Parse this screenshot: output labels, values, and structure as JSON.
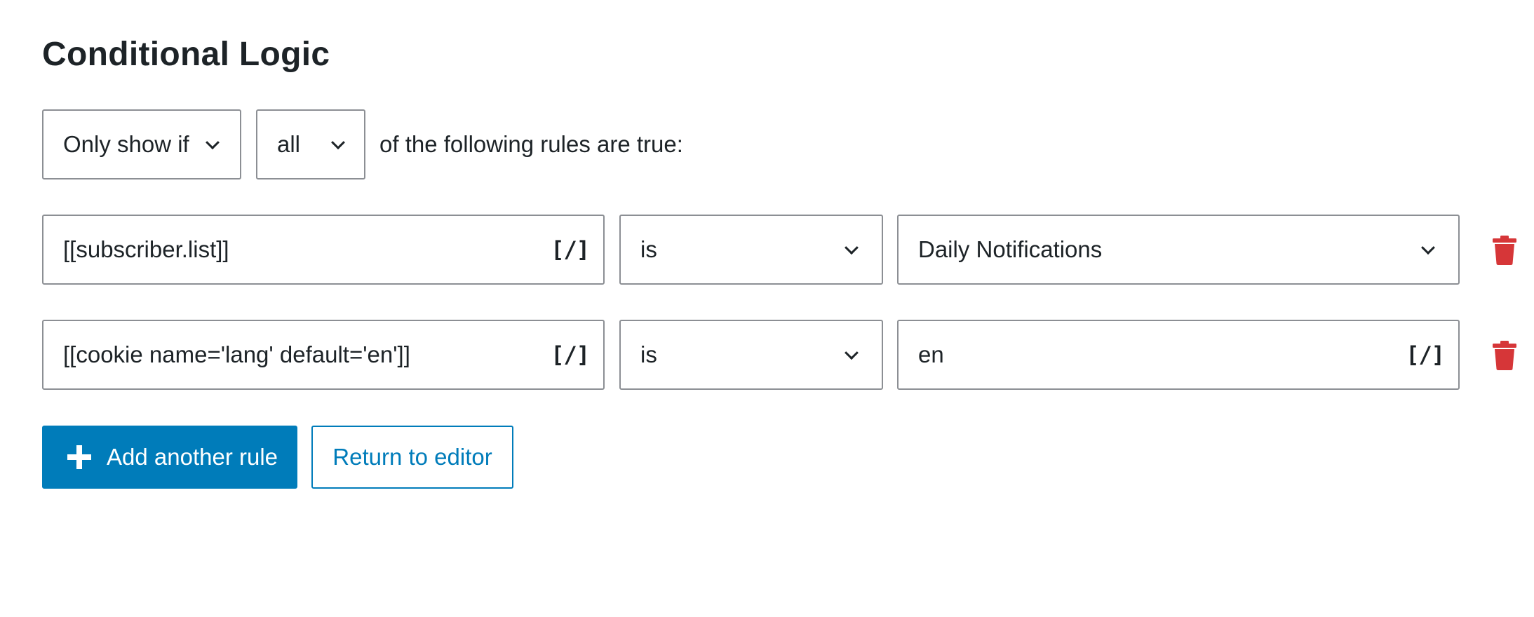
{
  "section": {
    "title": "Conditional Logic"
  },
  "logic_header": {
    "visibility_select": "Only show if",
    "match_select": "all",
    "suffix_text": "of the following rules are true:"
  },
  "rules": [
    {
      "field": "[[subscriber.list]]",
      "shortcode_icon": "[/]",
      "operator": "is",
      "value": "Daily Notifications",
      "value_type": "select"
    },
    {
      "field": "[[cookie name='lang' default='en']]",
      "shortcode_icon": "[/]",
      "operator": "is",
      "value": "en",
      "value_type": "text",
      "value_shortcode_icon": "[/]"
    }
  ],
  "actions": {
    "add_rule_label": "Add another rule",
    "return_label": "Return to editor"
  },
  "colors": {
    "primary": "#007cba",
    "danger": "#d63638",
    "border": "#8c8f94",
    "text": "#1d2327"
  }
}
